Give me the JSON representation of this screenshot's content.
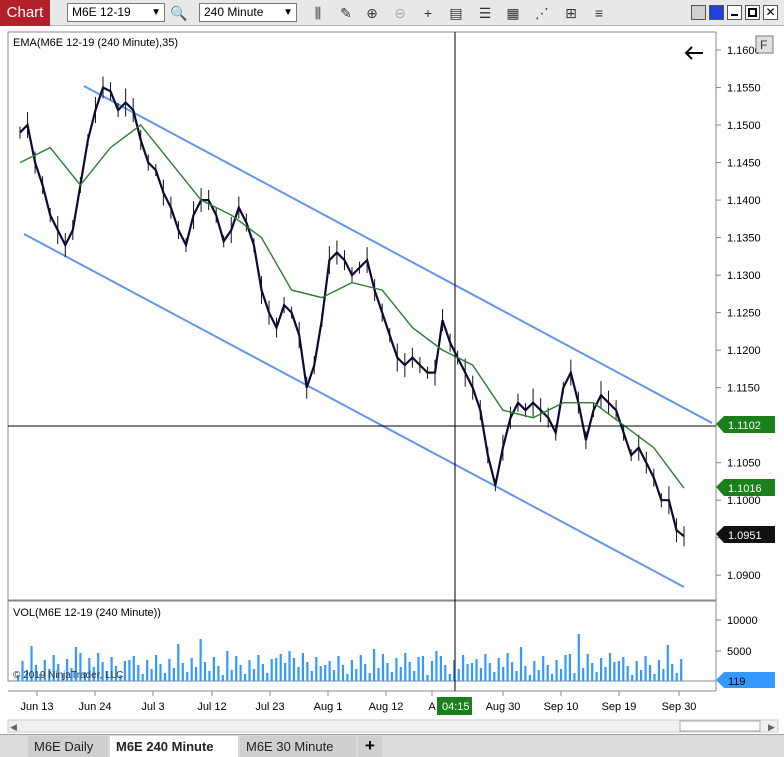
{
  "toolbar": {
    "app_label": "Chart",
    "instrument": "M6E 12-19",
    "interval": "240 Minute"
  },
  "colors": {
    "accent": "#b3202a",
    "channel": "#6495ed",
    "ema": "#2e7d32",
    "volume": "#3399ff",
    "price_label_green": "#1b7f1b"
  },
  "chart": {
    "ema_label": "EMA(M6E 12-19 (240 Minute),35)",
    "vol_label": "VOL(M6E 12-19 (240 Minute))",
    "copyright": "© 2019 NinjaTrader, LLC",
    "price_ticks": [
      "1.1600",
      "1.1550",
      "1.1500",
      "1.1450",
      "1.1400",
      "1.1350",
      "1.1300",
      "1.1250",
      "1.1200",
      "1.1150",
      "1.1050",
      "1.1000",
      "1.0950",
      "1.0900"
    ],
    "vol_ticks": [
      "10000",
      "5000"
    ],
    "date_ticks": [
      "Jun 13",
      "Jun 24",
      "Jul 3",
      "Jul 12",
      "Jul 23",
      "Aug 1",
      "Aug 12",
      "A",
      "Aug 30",
      "Sep 10",
      "Sep 19",
      "Sep 30"
    ],
    "crosshair_price": "1.1102",
    "ema_price": "1.1016",
    "last_price": "1.0951",
    "volume_value": "119",
    "crosshair_time": "04:15",
    "f_button": "F",
    "back_icon": "arrow-left-icon"
  },
  "tabs": [
    {
      "label": "M6E  Daily"
    },
    {
      "label": "M6E  240 Minute"
    },
    {
      "label": "M6E  30 Minute"
    }
  ],
  "add_tab_label": "+",
  "chart_data": {
    "type": "line",
    "ylim": [
      1.0867,
      1.1624
    ],
    "price_path": [
      [
        0,
        1.149
      ],
      [
        1,
        1.15
      ],
      [
        2,
        1.145
      ],
      [
        3,
        1.142
      ],
      [
        4,
        1.138
      ],
      [
        5,
        1.136
      ],
      [
        6,
        1.134
      ],
      [
        7,
        1.136
      ],
      [
        8,
        1.142
      ],
      [
        9,
        1.148
      ],
      [
        10,
        1.152
      ],
      [
        11,
        1.155
      ],
      [
        12,
        1.1545
      ],
      [
        13,
        1.152
      ],
      [
        14,
        1.153
      ],
      [
        15,
        1.152
      ],
      [
        16,
        1.148
      ],
      [
        17,
        1.145
      ],
      [
        18,
        1.144
      ],
      [
        19,
        1.141
      ],
      [
        20,
        1.139
      ],
      [
        21,
        1.136
      ],
      [
        22,
        1.134
      ],
      [
        23,
        1.138
      ],
      [
        24,
        1.14
      ],
      [
        25,
        1.14
      ],
      [
        26,
        1.138
      ],
      [
        27,
        1.1345
      ],
      [
        28,
        1.136
      ],
      [
        29,
        1.139
      ],
      [
        30,
        1.137
      ],
      [
        31,
        1.134
      ],
      [
        32,
        1.128
      ],
      [
        33,
        1.125
      ],
      [
        34,
        1.123
      ],
      [
        35,
        1.126
      ],
      [
        36,
        1.125
      ],
      [
        37,
        1.122
      ],
      [
        38,
        1.115
      ],
      [
        39,
        1.118
      ],
      [
        40,
        1.124
      ],
      [
        41,
        1.132
      ],
      [
        42,
        1.133
      ],
      [
        43,
        1.132
      ],
      [
        44,
        1.13
      ],
      [
        45,
        1.131
      ],
      [
        46,
        1.132
      ],
      [
        47,
        1.128
      ],
      [
        48,
        1.125
      ],
      [
        49,
        1.122
      ],
      [
        50,
        1.119
      ],
      [
        51,
        1.118
      ],
      [
        52,
        1.119
      ],
      [
        53,
        1.118
      ],
      [
        54,
        1.117
      ],
      [
        55,
        1.117
      ],
      [
        56,
        1.124
      ],
      [
        57,
        1.121
      ],
      [
        58,
        1.119
      ],
      [
        59,
        1.117
      ],
      [
        60,
        1.115
      ],
      [
        61,
        1.112
      ],
      [
        62,
        1.106
      ],
      [
        63,
        1.102
      ],
      [
        64,
        1.107
      ],
      [
        65,
        1.111
      ],
      [
        66,
        1.113
      ],
      [
        67,
        1.112
      ],
      [
        68,
        1.113
      ],
      [
        69,
        1.112
      ],
      [
        70,
        1.111
      ],
      [
        71,
        1.109
      ],
      [
        72,
        1.115
      ],
      [
        73,
        1.117
      ],
      [
        74,
        1.113
      ],
      [
        75,
        1.108
      ],
      [
        76,
        1.112
      ],
      [
        77,
        1.114
      ],
      [
        78,
        1.113
      ],
      [
        79,
        1.112
      ],
      [
        80,
        1.109
      ],
      [
        81,
        1.106
      ],
      [
        82,
        1.107
      ],
      [
        83,
        1.105
      ],
      [
        84,
        1.103
      ],
      [
        85,
        1.1
      ],
      [
        86,
        1.1
      ],
      [
        87,
        1.096
      ],
      [
        88,
        1.0952
      ]
    ],
    "ema_path": [
      [
        0,
        1.145
      ],
      [
        4,
        1.147
      ],
      [
        8,
        1.142
      ],
      [
        12,
        1.147
      ],
      [
        16,
        1.15
      ],
      [
        20,
        1.145
      ],
      [
        24,
        1.14
      ],
      [
        28,
        1.138
      ],
      [
        32,
        1.135
      ],
      [
        36,
        1.128
      ],
      [
        40,
        1.127
      ],
      [
        44,
        1.129
      ],
      [
        48,
        1.128
      ],
      [
        52,
        1.123
      ],
      [
        56,
        1.12
      ],
      [
        60,
        1.118
      ],
      [
        64,
        1.112
      ],
      [
        68,
        1.111
      ],
      [
        72,
        1.113
      ],
      [
        76,
        1.113
      ],
      [
        80,
        1.11
      ],
      [
        84,
        1.107
      ],
      [
        88,
        1.1016
      ]
    ]
  }
}
